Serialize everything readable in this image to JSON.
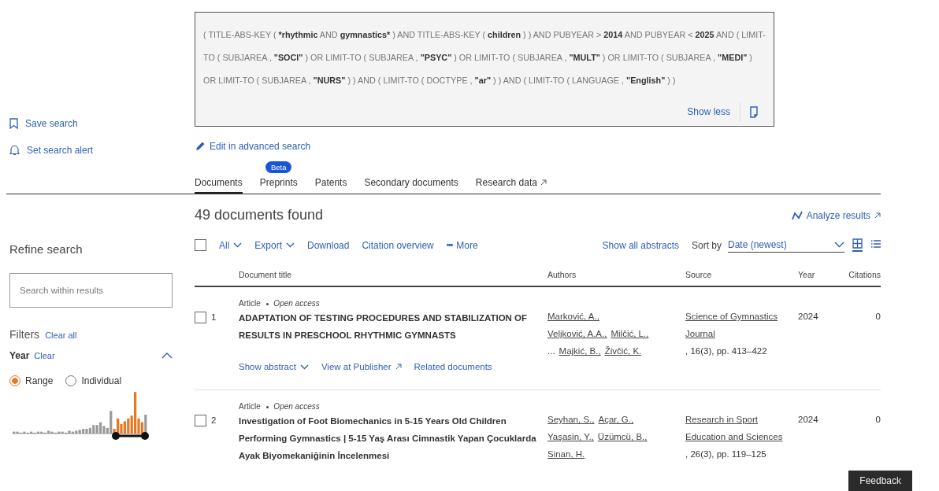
{
  "query": {
    "segments": [
      {
        "text": "( TITLE-ABS-KEY ( ",
        "bold": false
      },
      {
        "text": "*rhythmic",
        "bold": true
      },
      {
        "text": " AND ",
        "bold": false
      },
      {
        "text": "gymnastics*",
        "bold": true
      },
      {
        "text": " ) AND TITLE-ABS-KEY ( ",
        "bold": false
      },
      {
        "text": "children",
        "bold": true
      },
      {
        "text": " ) ) AND PUBYEAR > ",
        "bold": false
      },
      {
        "text": "2014",
        "bold": true
      },
      {
        "text": " AND PUBYEAR < ",
        "bold": false
      },
      {
        "text": "2025",
        "bold": true
      },
      {
        "text": " AND ( LIMIT-TO ( SUBJAREA , ",
        "bold": false
      },
      {
        "text": "\"SOCI\"",
        "bold": true
      },
      {
        "text": " ) OR LIMIT-TO ( SUBJAREA , ",
        "bold": false
      },
      {
        "text": "\"PSYC\"",
        "bold": true
      },
      {
        "text": " ) OR LIMIT-TO ( SUBJAREA , ",
        "bold": false
      },
      {
        "text": "\"MULT\"",
        "bold": true
      },
      {
        "text": " ) OR LIMIT-TO ( SUBJAREA , ",
        "bold": false
      },
      {
        "text": "\"MEDI\"",
        "bold": true
      },
      {
        "text": " ) OR LIMIT-TO ( SUBJAREA , ",
        "bold": false
      },
      {
        "text": "\"NURS\"",
        "bold": true
      },
      {
        "text": " ) ) AND ( LIMIT-TO ( DOCTYPE , ",
        "bold": false
      },
      {
        "text": "\"ar\"",
        "bold": true
      },
      {
        "text": " ) ) AND ( LIMIT-TO ( LANGUAGE , ",
        "bold": false
      },
      {
        "text": "\"English\"",
        "bold": true
      },
      {
        "text": " ) )",
        "bold": false
      }
    ],
    "show_less": "Show less"
  },
  "side_links": [
    {
      "kind": "bookmark",
      "label": "Save search"
    },
    {
      "kind": "bell",
      "label": "Set search alert"
    }
  ],
  "edit_link": "Edit in advanced search",
  "tabs": [
    {
      "label": "Documents",
      "selected": true
    },
    {
      "label": "Preprints",
      "selected": false,
      "badge": "Beta"
    },
    {
      "label": "Patents",
      "selected": false
    },
    {
      "label": "Secondary documents",
      "selected": false
    },
    {
      "label": "Research data",
      "selected": false,
      "external": true
    }
  ],
  "sidebar": {
    "title": "Refine search",
    "search_placeholder": "Search within results",
    "filters_title": "Filters",
    "clear_all": "Clear all",
    "year_label": "Year",
    "year_clear": "Clear",
    "year_expanded": true,
    "radios": [
      {
        "label": "Range",
        "selected": true
      },
      {
        "label": "Individual",
        "selected": false
      }
    ]
  },
  "results": {
    "count": "49 documents found",
    "analyze": "Analyze results",
    "toolbar": {
      "select_all_checked": false,
      "all": "All",
      "export": "Export",
      "download": "Download",
      "citation_overview": "Citation overview",
      "more_icon": "•••",
      "more": "More",
      "show_all_abstracts": "Show all abstracts",
      "sort_label": "Sort by",
      "sort_value": "Date (newest)"
    },
    "views": [
      {
        "kind": "grid",
        "selected": true
      },
      {
        "kind": "list",
        "selected": false
      }
    ],
    "columns": [
      "Document title",
      "Authors",
      "Source",
      "Year",
      "Citations"
    ],
    "rows": [
      {
        "index": "1",
        "checked": false,
        "type": "Article",
        "access": "Open access",
        "title": "ADAPTATION OF TESTING PROCEDURES AND STABILIZATION OF RESULTS IN PRESCHOOL RHYTHMIC GYMNASTS",
        "authors_lines": [
          [
            "Marković, A.,"
          ],
          [
            "Veljković, A.A.,",
            "Milčić, L.,"
          ],
          [
            "...",
            "Majkić, B.,",
            "Živčić, K."
          ]
        ],
        "source": "Science of Gymnastics Journal",
        "source_detail": ", 16(3), pp. 413–422",
        "year": "2024",
        "citations": "0",
        "actions": [
          "Show abstract",
          "View at Publisher",
          "Related documents"
        ]
      },
      {
        "index": "2",
        "checked": false,
        "type": "Article",
        "access": "Open access",
        "title": "Investigation of Foot Biomechanics in 5-15 Years Old Children Performing Gymnastics | 5-15 Yaş Arası Cimnastik Yapan Çocuklarda Ayak Biyomekaniğinin İncelenmesi",
        "authors_lines": [
          [
            "Seyhan, S.,",
            "Açar, G.,"
          ],
          [
            "Yaşasin, Y.,",
            "Üzümcü, B.,"
          ],
          [
            "Sinan, H."
          ]
        ],
        "source": "Research in Sport Education and Sciences",
        "source_detail": ", 26(3), pp. 119–125",
        "year": "2024",
        "citations": "0",
        "actions": []
      }
    ]
  },
  "feedback": "Feedback"
}
